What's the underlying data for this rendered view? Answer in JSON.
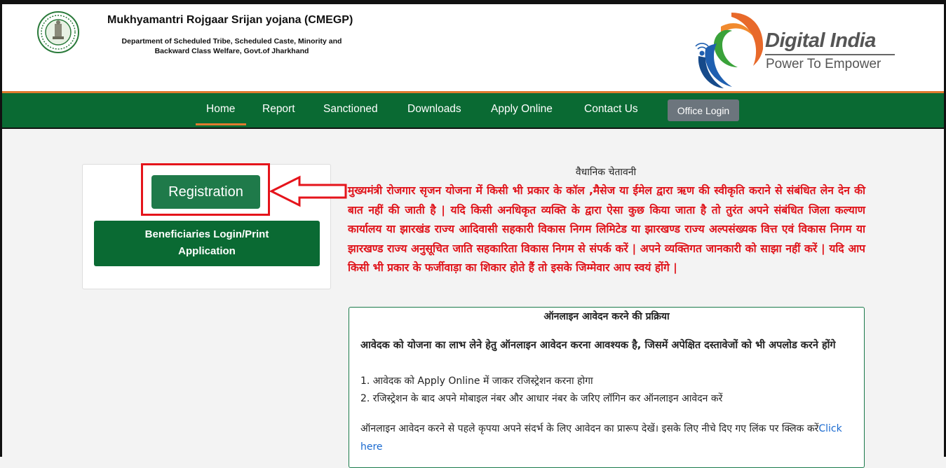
{
  "header": {
    "title": "Mukhyamantri Rojgaar Srijan yojana (CMEGP)",
    "subtitle_line1": "Department of Scheduled Tribe, Scheduled Caste, Minority and",
    "subtitle_line2": "Backward Class Welfare, Govt.of Jharkhand",
    "logo_title": "Digital India",
    "logo_tagline": "Power To Empower",
    "emblem_icon": "jharkhand-govt-seal-icon"
  },
  "nav": {
    "items": [
      "Home",
      "Report",
      "Sanctioned",
      "Downloads",
      "Apply Online",
      "Contact Us"
    ],
    "active": "Home",
    "office_login": "Office Login"
  },
  "left_panel": {
    "registration": "Registration",
    "beneficiaries_line1": "Beneficiaries Login/Print",
    "beneficiaries_line2": "Application"
  },
  "warning": {
    "title": "वैधानिक चेतावनी",
    "text": "मुख्यमंत्री रोजगार सृजन योजना में किसी भी प्रकार के कॉल ,मैसेज या ईमेल द्वारा ऋण की स्वीकृति कराने से संबंधित लेन देन की बात नहीं की जाती है | यदि किसी अनधिकृत व्यक्ति के द्वारा ऐसा कुछ किया जाता है तो तुरंत अपने संबंधित जिला कल्याण कार्यालय या झारखंड राज्य आदिवासी सहकारी विकास निगम लिमिटेड या झारखण्ड राज्य अल्पसंख्यक वित्त एवं विकास निगम या झारखण्ड राज्य अनुसूचित जाति सहकारिता विकास निगम से संपर्क करें | अपने व्यक्तिगत जानकारी को साझा नहीं करें | यदि आप किसी भी प्रकार के फर्जीवाड़ा का शिकार होते हैं तो इसके जिम्मेवार आप स्वयं होंगे |"
  },
  "process": {
    "title": "ऑनलाइन आवेदन करने की प्रक्रिया",
    "lead": "आवेदक को योजना का लाभ लेने हेतु ऑनलाइन आवेदन करना आवश्यक है, जिसमें अपेक्षित दस्तावेजों को भी अपलोड करने होंगे",
    "step1": "1. आवेदक को Apply Online में जाकर रजिस्ट्रेशन करना होगा",
    "step2": "2. रजिस्ट्रेशन के बाद अपने मोबाइल नंबर और आधार नंबर के जरिए लॉगिन कर ऑनलाइन आवेदन करें",
    "note": "ऑनलाइन आवेदन करने से पहले कृपया अपने संदर्भ के लिए आवेदन का प्रारूप देखें। इसके लिए नीचे दिए गए लिंक पर क्लिक करें",
    "link": "Click here"
  },
  "colors": {
    "nav_green": "#0a6a33",
    "accent_orange": "#e07a2e",
    "warning_red": "#e0131a",
    "highlight_red": "#e5141b",
    "link_blue": "#1a6ad0"
  }
}
